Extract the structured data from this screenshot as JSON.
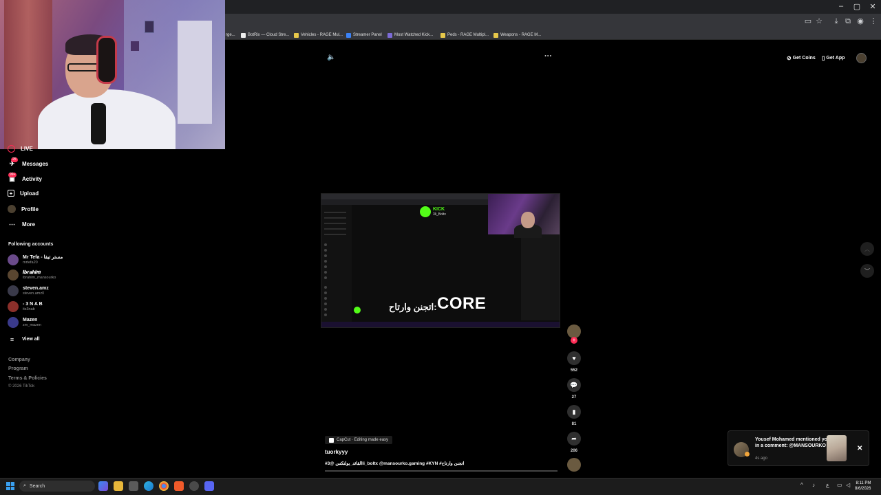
{
  "browser": {
    "bookmarks": [
      {
        "label": "rge...",
        "color": "#888888"
      },
      {
        "label": "BotRix — Cloud Stre...",
        "color": "#eeeeee"
      },
      {
        "label": "Vehicles - RAGE Mul...",
        "color": "#e7c84a"
      },
      {
        "label": "Streamer Panel",
        "color": "#3b82f6"
      },
      {
        "label": "Most Watched Kick...",
        "color": "#7c6bd6"
      },
      {
        "label": "Peds - RAGE Multipl...",
        "color": "#e7c84a"
      },
      {
        "label": "Weapons - RAGE M...",
        "color": "#e7c84a"
      }
    ],
    "window_controls": {
      "minimize": "–",
      "maximize": "▢",
      "close": "✕"
    }
  },
  "sidebar": {
    "live_label": "LIVE",
    "items": [
      {
        "label": "Messages",
        "badge": "25",
        "icon": "paper-plane-icon"
      },
      {
        "label": "Activity",
        "badge": "99+",
        "icon": "inbox-icon"
      },
      {
        "label": "Upload",
        "icon": "plus-square-icon"
      },
      {
        "label": "Profile",
        "icon": "avatar-icon"
      },
      {
        "label": "More",
        "icon": "more-dots-icon"
      }
    ],
    "following_title": "Following accounts",
    "accounts": [
      {
        "name": "Mr Tefa - مستر تيفا",
        "user": "mrtefa20",
        "color": "#6a4a8a"
      },
      {
        "name": "𝑰𝒃𝒓𝒂𝒉𝒊𝒎",
        "user": "ibrahim_mansourko",
        "color": "#5a4630"
      },
      {
        "name": "steven.amz",
        "user": "steven.amz0",
        "color": "#3a3a4a"
      },
      {
        "name": "- 3 N A B",
        "user": "its3nab",
        "color": "#8a2f2a"
      },
      {
        "name": "Mazen",
        "user": "zm_mazen",
        "color": "#3a3a8a"
      }
    ],
    "view_all": "View all",
    "footer": {
      "company": "Company",
      "program": "Program",
      "terms": "Terms & Policies",
      "copyright": "© 2026 TikTok"
    }
  },
  "header": {
    "get_coins": "Get Coins",
    "get_app": "Get App"
  },
  "video": {
    "kick_brand": "KICK",
    "kick_user": "3li_Boltx",
    "caption_arabic": "اتجنن وارتاح:",
    "caption_core": "CORE",
    "capcut": "CapCut · Editing made easy",
    "author": "tuorkyyy",
    "description": "#القائد_بولتكس @3li_boltx @mansourko.gaming #KYN #اتجنن وارتاح"
  },
  "actions": {
    "likes": "552",
    "comments": "27",
    "saves": "81",
    "shares": "206"
  },
  "notification": {
    "title": "Yousef Mohamed mentioned you in a comment: @MANSOURKO",
    "time": "4s ago"
  },
  "taskbar": {
    "search": "Search",
    "time": "8:11 PM",
    "date": "8/6/2026"
  }
}
